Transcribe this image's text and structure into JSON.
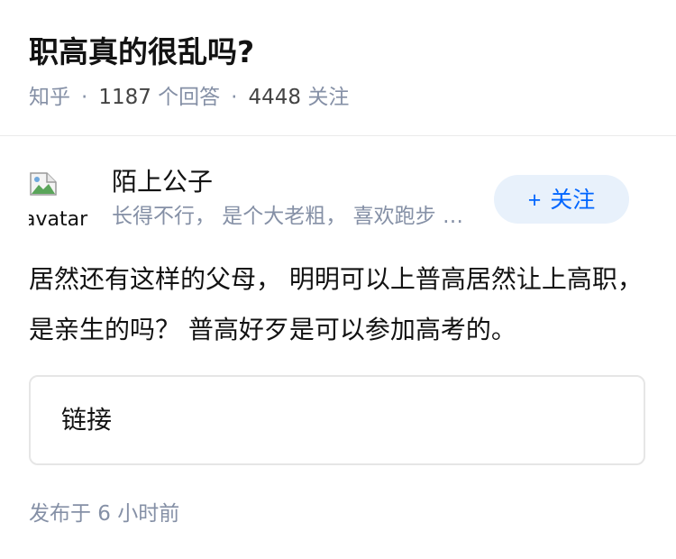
{
  "question": {
    "title": "职高真的很乱吗?",
    "source": "知乎",
    "separator": "·",
    "answer_count": "1187",
    "answer_count_label": "个回答",
    "follower_count": "4448",
    "follower_count_label": "关注"
  },
  "author": {
    "avatar_alt": "avatar",
    "name": "陌上公子",
    "bio": "长得不行， 是个大老粗， 喜欢跑步 ，读书，写作，爱生活",
    "follow_plus": "+",
    "follow_label": "关注"
  },
  "answer": {
    "text": "居然还有这样的父母， 明明可以上普高居然让上高职，是亲生的吗？ 普高好歹是可以参加高考的。",
    "link_label": "链接",
    "published": "发布于  6 小时前"
  },
  "colors": {
    "accent": "#0066ff",
    "follow_bg": "#e8f1fb",
    "muted_text": "#8590a6"
  }
}
